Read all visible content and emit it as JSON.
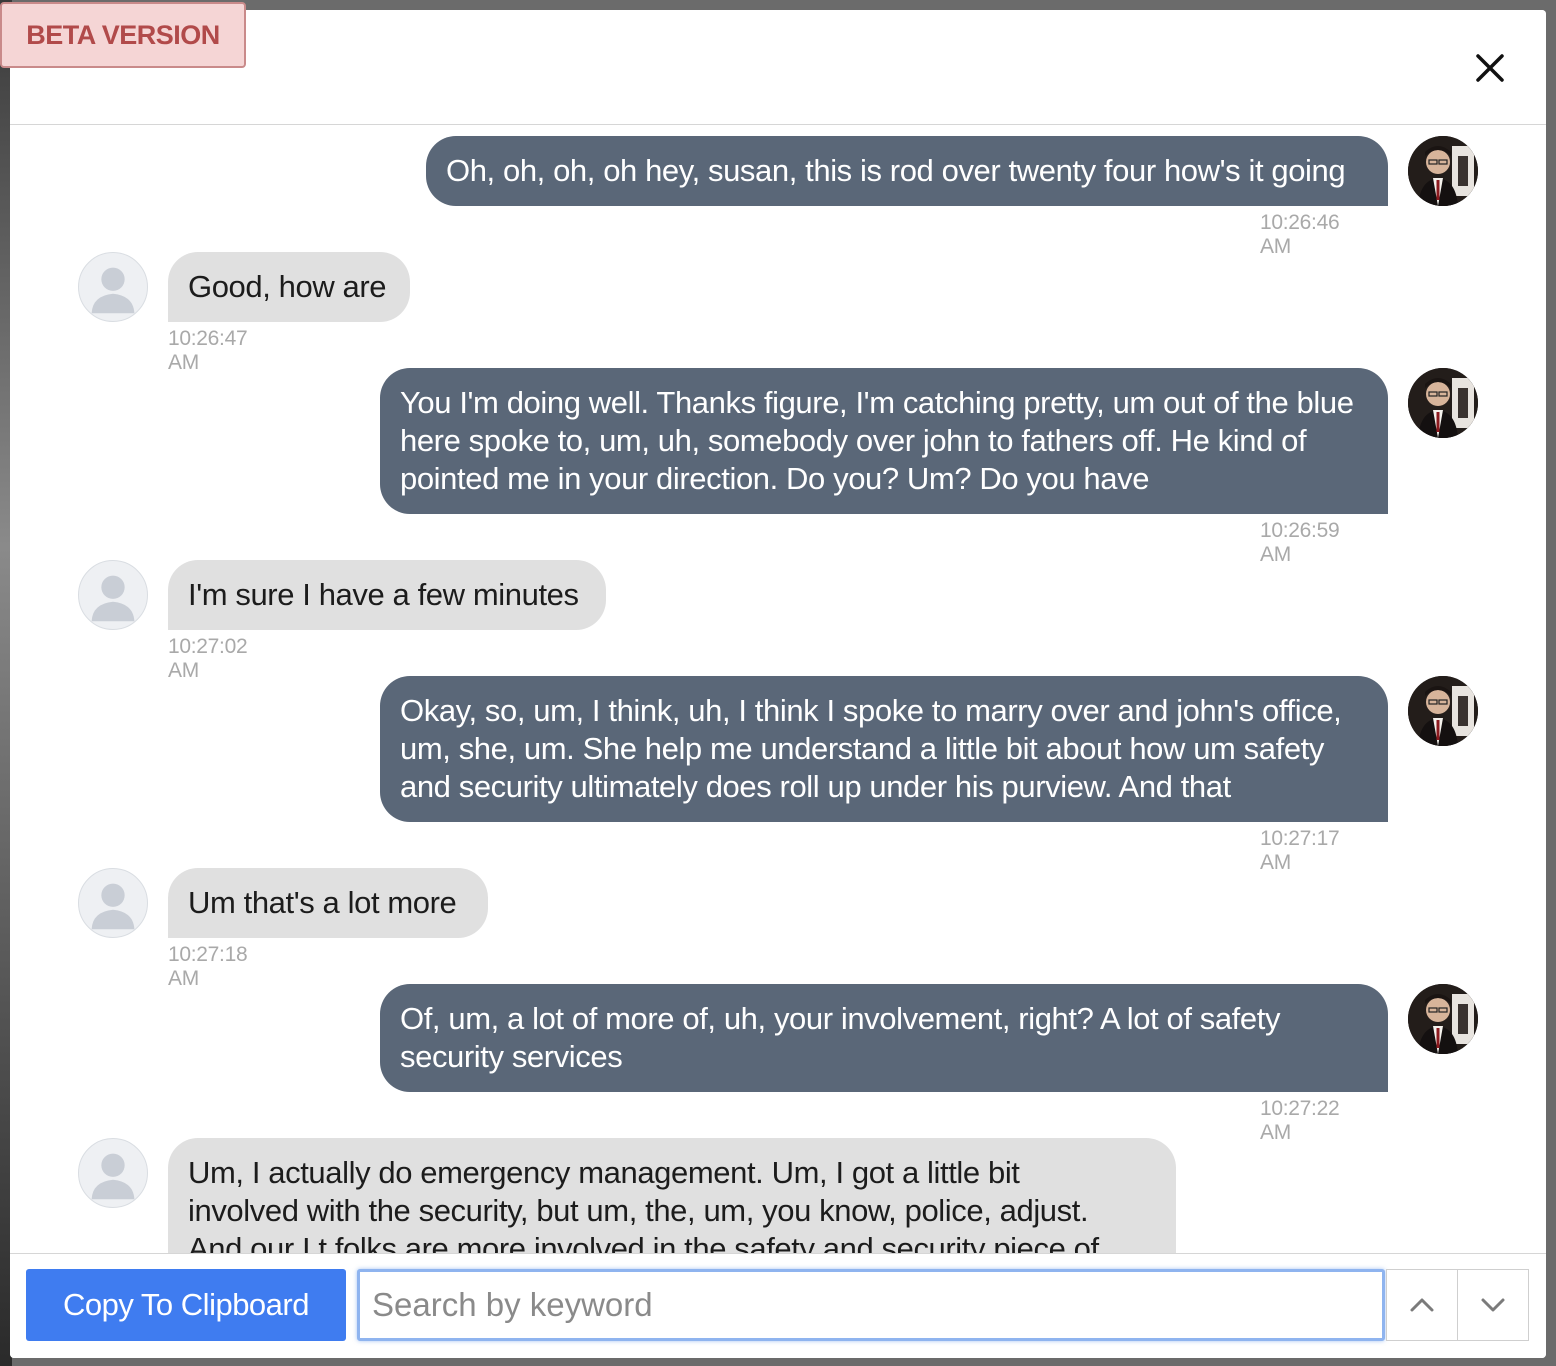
{
  "header": {
    "beta_label": "BETA VERSION",
    "close_icon": "close-icon"
  },
  "messages": [
    {
      "direction": "out",
      "text": "Oh, oh, oh, oh hey, susan, this is rod over twenty four how's it going",
      "time": "10:26:46 AM"
    },
    {
      "direction": "in",
      "text": "Good, how are",
      "time": "10:26:47 AM"
    },
    {
      "direction": "out",
      "text": "You I'm doing well. Thanks figure, I'm catching pretty, um out of the blue here spoke to, um, uh, somebody over john to fathers off. He kind of pointed me in your direction. Do you? Um? Do you have",
      "time": "10:26:59 AM"
    },
    {
      "direction": "in",
      "text": "I'm sure I have a few minutes",
      "time": "10:27:02 AM"
    },
    {
      "direction": "out",
      "text": "Okay, so, um, I think, uh, I think I spoke to marry over and john's office, um, she, um. She help me understand a little bit about how um safety and security ultimately does roll up under his purview. And that",
      "time": "10:27:17 AM"
    },
    {
      "direction": "in",
      "text": "Um that's a lot more",
      "time": "10:27:18 AM"
    },
    {
      "direction": "out",
      "text": "Of, um, a lot of more of, uh, your involvement, right? A lot of safety security services",
      "time": "10:27:22 AM"
    },
    {
      "direction": "in",
      "text": "Um, I actually do emergency management. Um, I got a little bit involved with the security, but um, the, um, you know, police, adjust. And our I t folks are more involved in the safety and security piece of",
      "time": ""
    }
  ],
  "footer": {
    "copy_label": "Copy To Clipboard",
    "search_placeholder": "Search by keyword",
    "prev_icon": "chevron-up-icon",
    "next_icon": "chevron-down-icon"
  },
  "colors": {
    "outgoing_bubble": "#5a6778",
    "incoming_bubble": "#e0e0e0",
    "copy_button": "#3f7cf0",
    "beta_badge_bg": "#f5d5d5",
    "beta_badge_text": "#b14a4a"
  }
}
